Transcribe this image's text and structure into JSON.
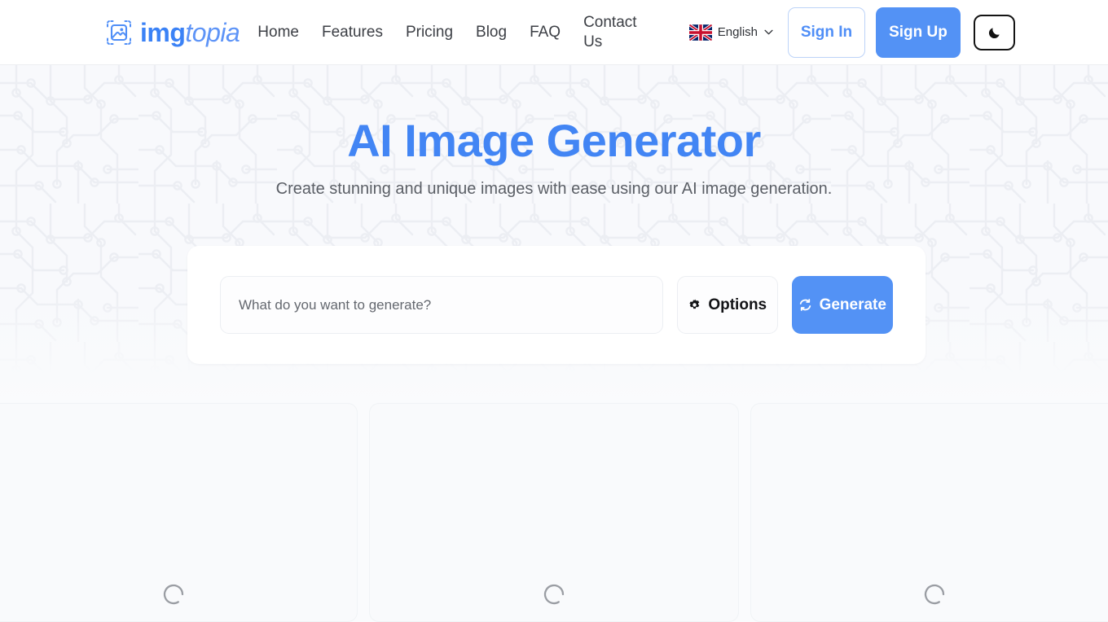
{
  "header": {
    "logo_icon": "image-frame-icon",
    "brand_part1": "img",
    "brand_part2": "topia",
    "nav": [
      {
        "label": "Home",
        "name": "nav-home"
      },
      {
        "label": "Features",
        "name": "nav-features"
      },
      {
        "label": "Pricing",
        "name": "nav-pricing"
      },
      {
        "label": "Blog",
        "name": "nav-blog"
      },
      {
        "label": "FAQ",
        "name": "nav-faq"
      },
      {
        "label": "Contact Us",
        "name": "nav-contact-us"
      }
    ],
    "language": {
      "label": "English",
      "flag_icon": "uk-flag-icon",
      "chevron_icon": "chevron-down-icon"
    },
    "sign_in_label": "Sign In",
    "sign_up_label": "Sign Up",
    "theme_toggle_icon": "moon-icon"
  },
  "hero": {
    "title": "AI Image Generator",
    "subtitle": "Create stunning and unique images with ease using our AI image generation.",
    "background_pattern": "circuit-board-pattern"
  },
  "prompt": {
    "placeholder": "What do you want to generate?",
    "value": "",
    "options_label": "Options",
    "options_icon": "gear-icon",
    "generate_label": "Generate",
    "generate_icon": "refresh-sync-icon"
  },
  "results": {
    "cards": [
      {
        "status": "loading",
        "spinner_icon": "loading-spinner-icon"
      },
      {
        "status": "loading",
        "spinner_icon": "loading-spinner-icon"
      },
      {
        "status": "loading",
        "spinner_icon": "loading-spinner-icon"
      }
    ]
  },
  "colors": {
    "brand_blue": "#4285f4",
    "button_blue": "#5392f5",
    "hero_bg": "#f8f9fc",
    "text_dark": "#303030",
    "text_muted": "#5b5f66",
    "spinner_gray": "#9a9da3"
  }
}
